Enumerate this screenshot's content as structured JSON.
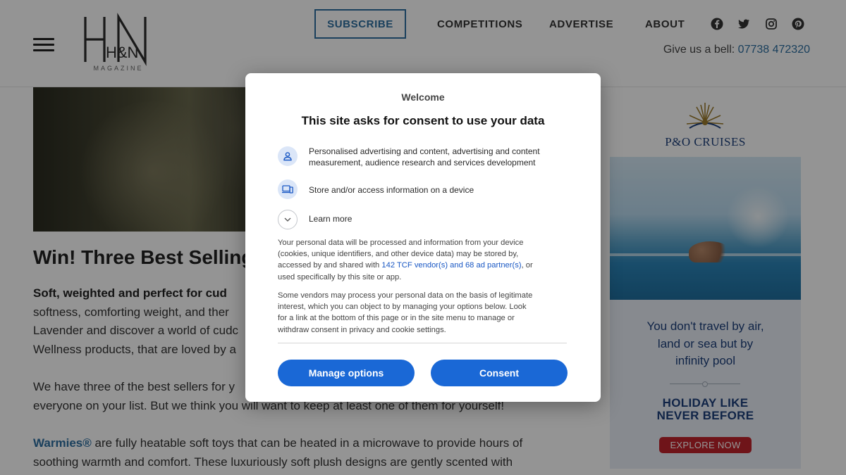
{
  "header": {
    "logo_text": "H&N",
    "logo_tagline": "MAGAZINE",
    "menu_icon": "hamburger-menu-icon",
    "nav": {
      "subscribe": "SUBSCRIBE",
      "competitions": "COMPETITIONS",
      "advertise": "ADVERTISE",
      "about": "ABOUT"
    },
    "social_icons": [
      "facebook-icon",
      "twitter-icon",
      "instagram-icon",
      "pinterest-icon"
    ],
    "phone_label": "Give us a bell:",
    "phone_number": "07738 472320"
  },
  "article": {
    "title": "Win! Three Best Selling",
    "para1": {
      "lead": "Soft, weighted and perfect for cud",
      "lines": [
        "softness, comforting weight, and ther",
        "Lavender and discover a world of cudc",
        "Wellness products, that are loved by a"
      ]
    },
    "para2": {
      "lines": [
        "We have three of the best sellers for y",
        "everyone on your list. But we think you will want to keep at least one of them for yourself!"
      ]
    },
    "para3": {
      "brand": "Warmies®",
      "line1_rest": " are fully heatable soft toys that can be heated in a microwave to provide hours of",
      "line2": "soothing warmth and comfort. These luxuriously soft plush designs are gently scented with"
    }
  },
  "ad": {
    "brand": "P&O CRUISES",
    "tagline": [
      "You don't travel by air,",
      "land or sea but by",
      "infinity pool"
    ],
    "headline": [
      "HOLIDAY LIKE",
      "NEVER BEFORE"
    ],
    "cta": "EXPLORE NOW"
  },
  "consent": {
    "welcome": "Welcome",
    "title": "This site asks for consent to use your data",
    "items": [
      {
        "icon": "person-icon",
        "lines": [
          "Personalised advertising and content, advertising and content",
          "measurement, audience research and services development"
        ]
      },
      {
        "icon": "devices-icon",
        "lines": [
          "Store and/or access information on a device"
        ]
      }
    ],
    "learn_more_icon": "chevron-down-icon",
    "learn_more": "Learn more",
    "body1": {
      "line1": "Your personal data will be processed and information from your device",
      "line2": "(cookies, unique identifiers, and other device data) may be stored by,",
      "line3_pre": "accessed by and shared with ",
      "vendors_link": "142 TCF vendor(s) and 68 ad partner(s)",
      "line3_post": ", or",
      "line4": "used specifically by this site or app."
    },
    "body2": [
      "Some vendors may process your personal data on the basis of legitimate",
      "interest, which you can object to by managing your options below. Look",
      "for a link at the bottom of this page or in the site menu to manage or",
      "withdraw consent in privacy and cookie settings."
    ],
    "manage_button": "Manage options",
    "consent_button": "Consent",
    "accent_color": "#1a68d6"
  }
}
